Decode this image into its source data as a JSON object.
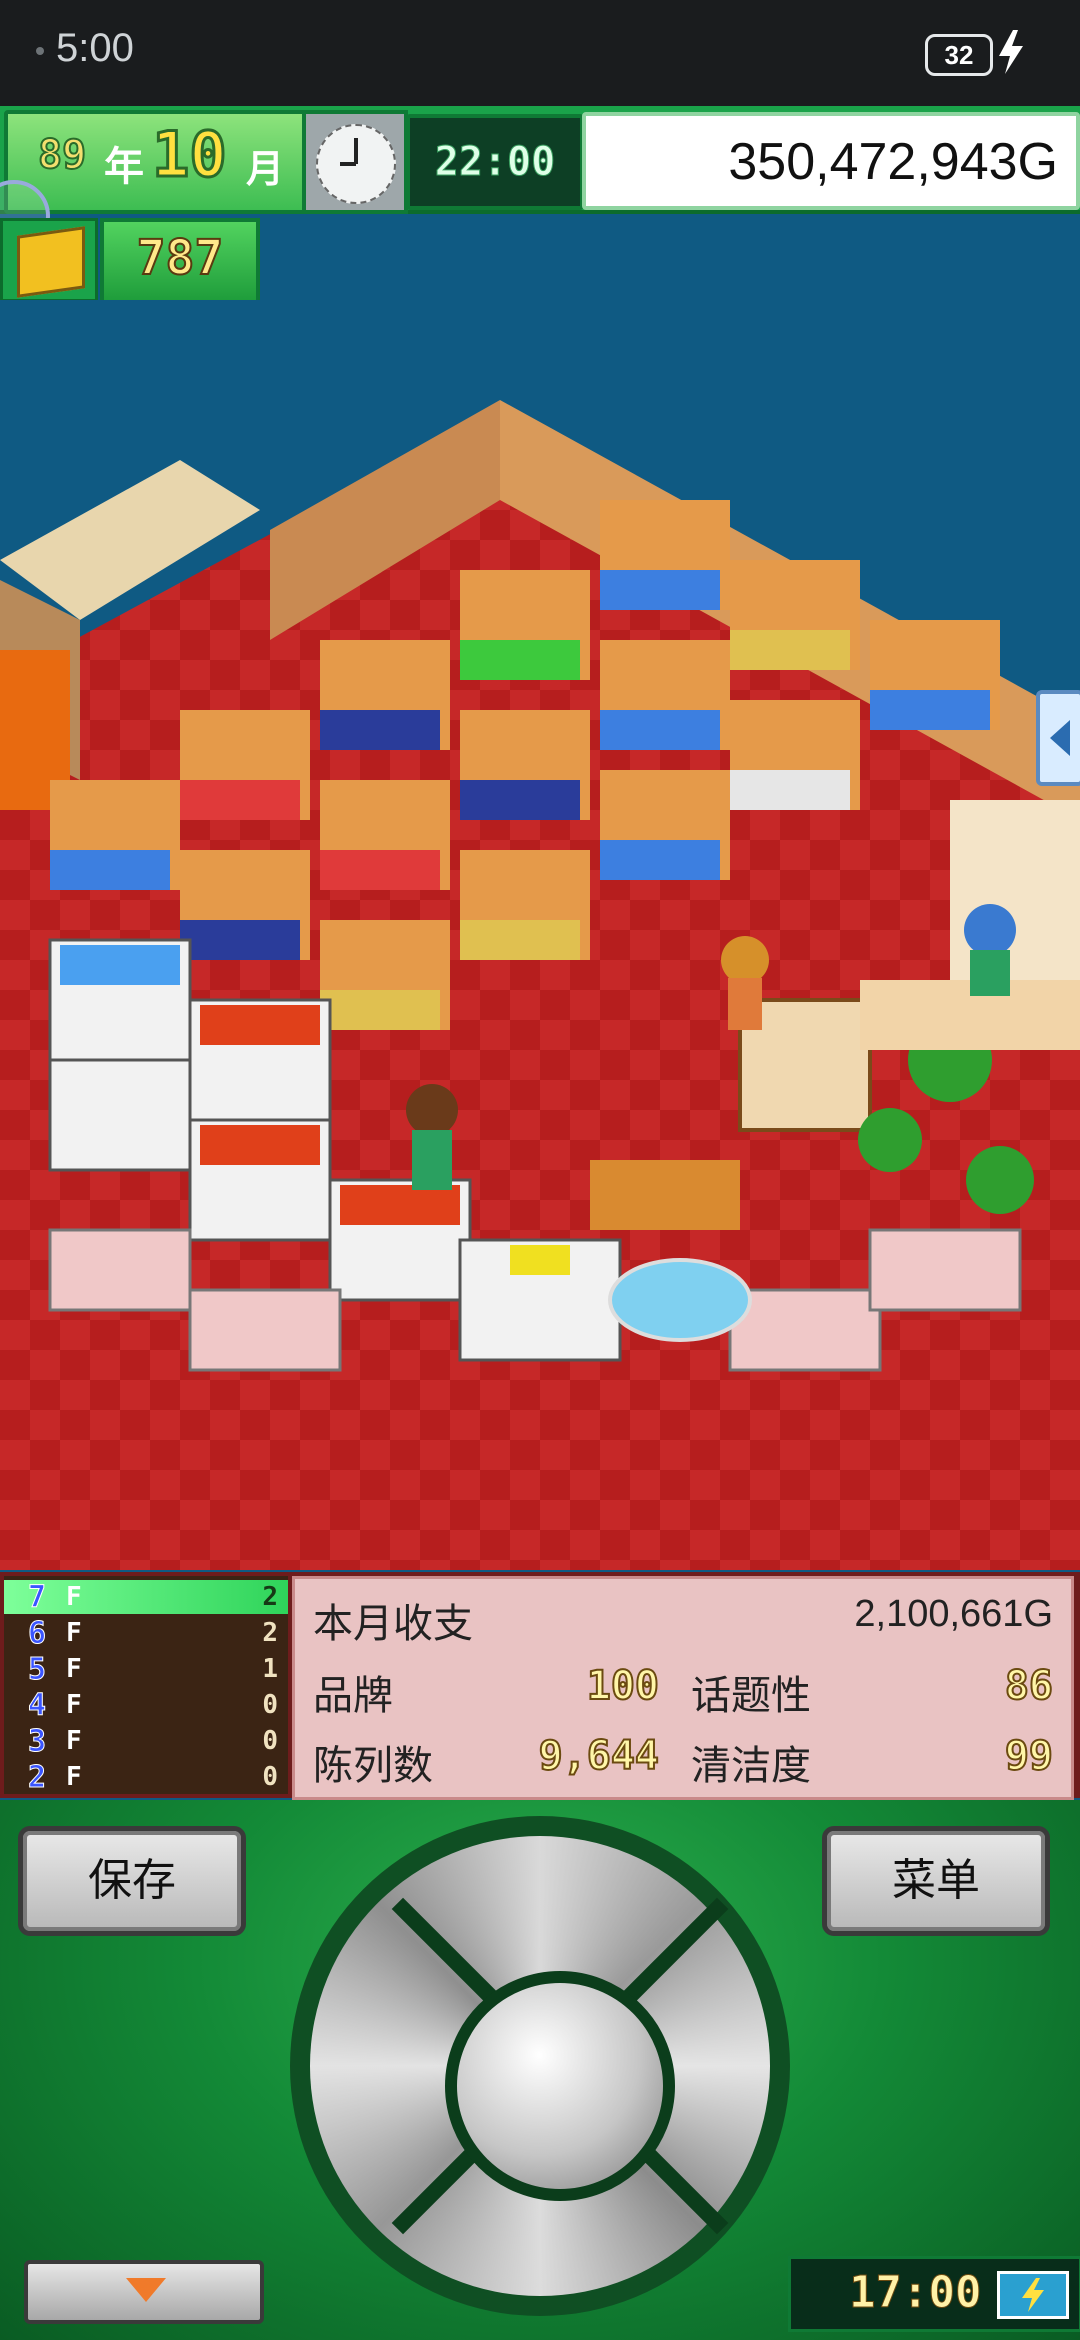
{
  "status_bar": {
    "time": "5:00",
    "battery": "32"
  },
  "hud": {
    "year": "89",
    "year_char": "年",
    "month": "10",
    "month_char": "月",
    "time": "22:00",
    "money": "350,472,943G",
    "points": "787"
  },
  "floors": [
    {
      "floor": "7",
      "f": "F",
      "count": "2"
    },
    {
      "floor": "6",
      "f": "F",
      "count": "2"
    },
    {
      "floor": "5",
      "f": "F",
      "count": "1"
    },
    {
      "floor": "4",
      "f": "F",
      "count": "0"
    },
    {
      "floor": "3",
      "f": "F",
      "count": "0"
    },
    {
      "floor": "2",
      "f": "F",
      "count": "0"
    }
  ],
  "stats": {
    "monthly_label": "本月收支",
    "monthly_value": "2,100,661G",
    "brand_label": "品牌",
    "brand_value": "100",
    "buzz_label": "话题性",
    "buzz_value": "86",
    "display_label": "陈列数",
    "display_value": "9,644",
    "clean_label": "清洁度",
    "clean_value": "99"
  },
  "controls": {
    "save_label": "保存",
    "menu_label": "菜单",
    "bottom_time": "17:00"
  },
  "colors": {
    "hud_green": "#1aa34a",
    "floor_red": "#b81f1f",
    "sky": "#0f5a83"
  }
}
